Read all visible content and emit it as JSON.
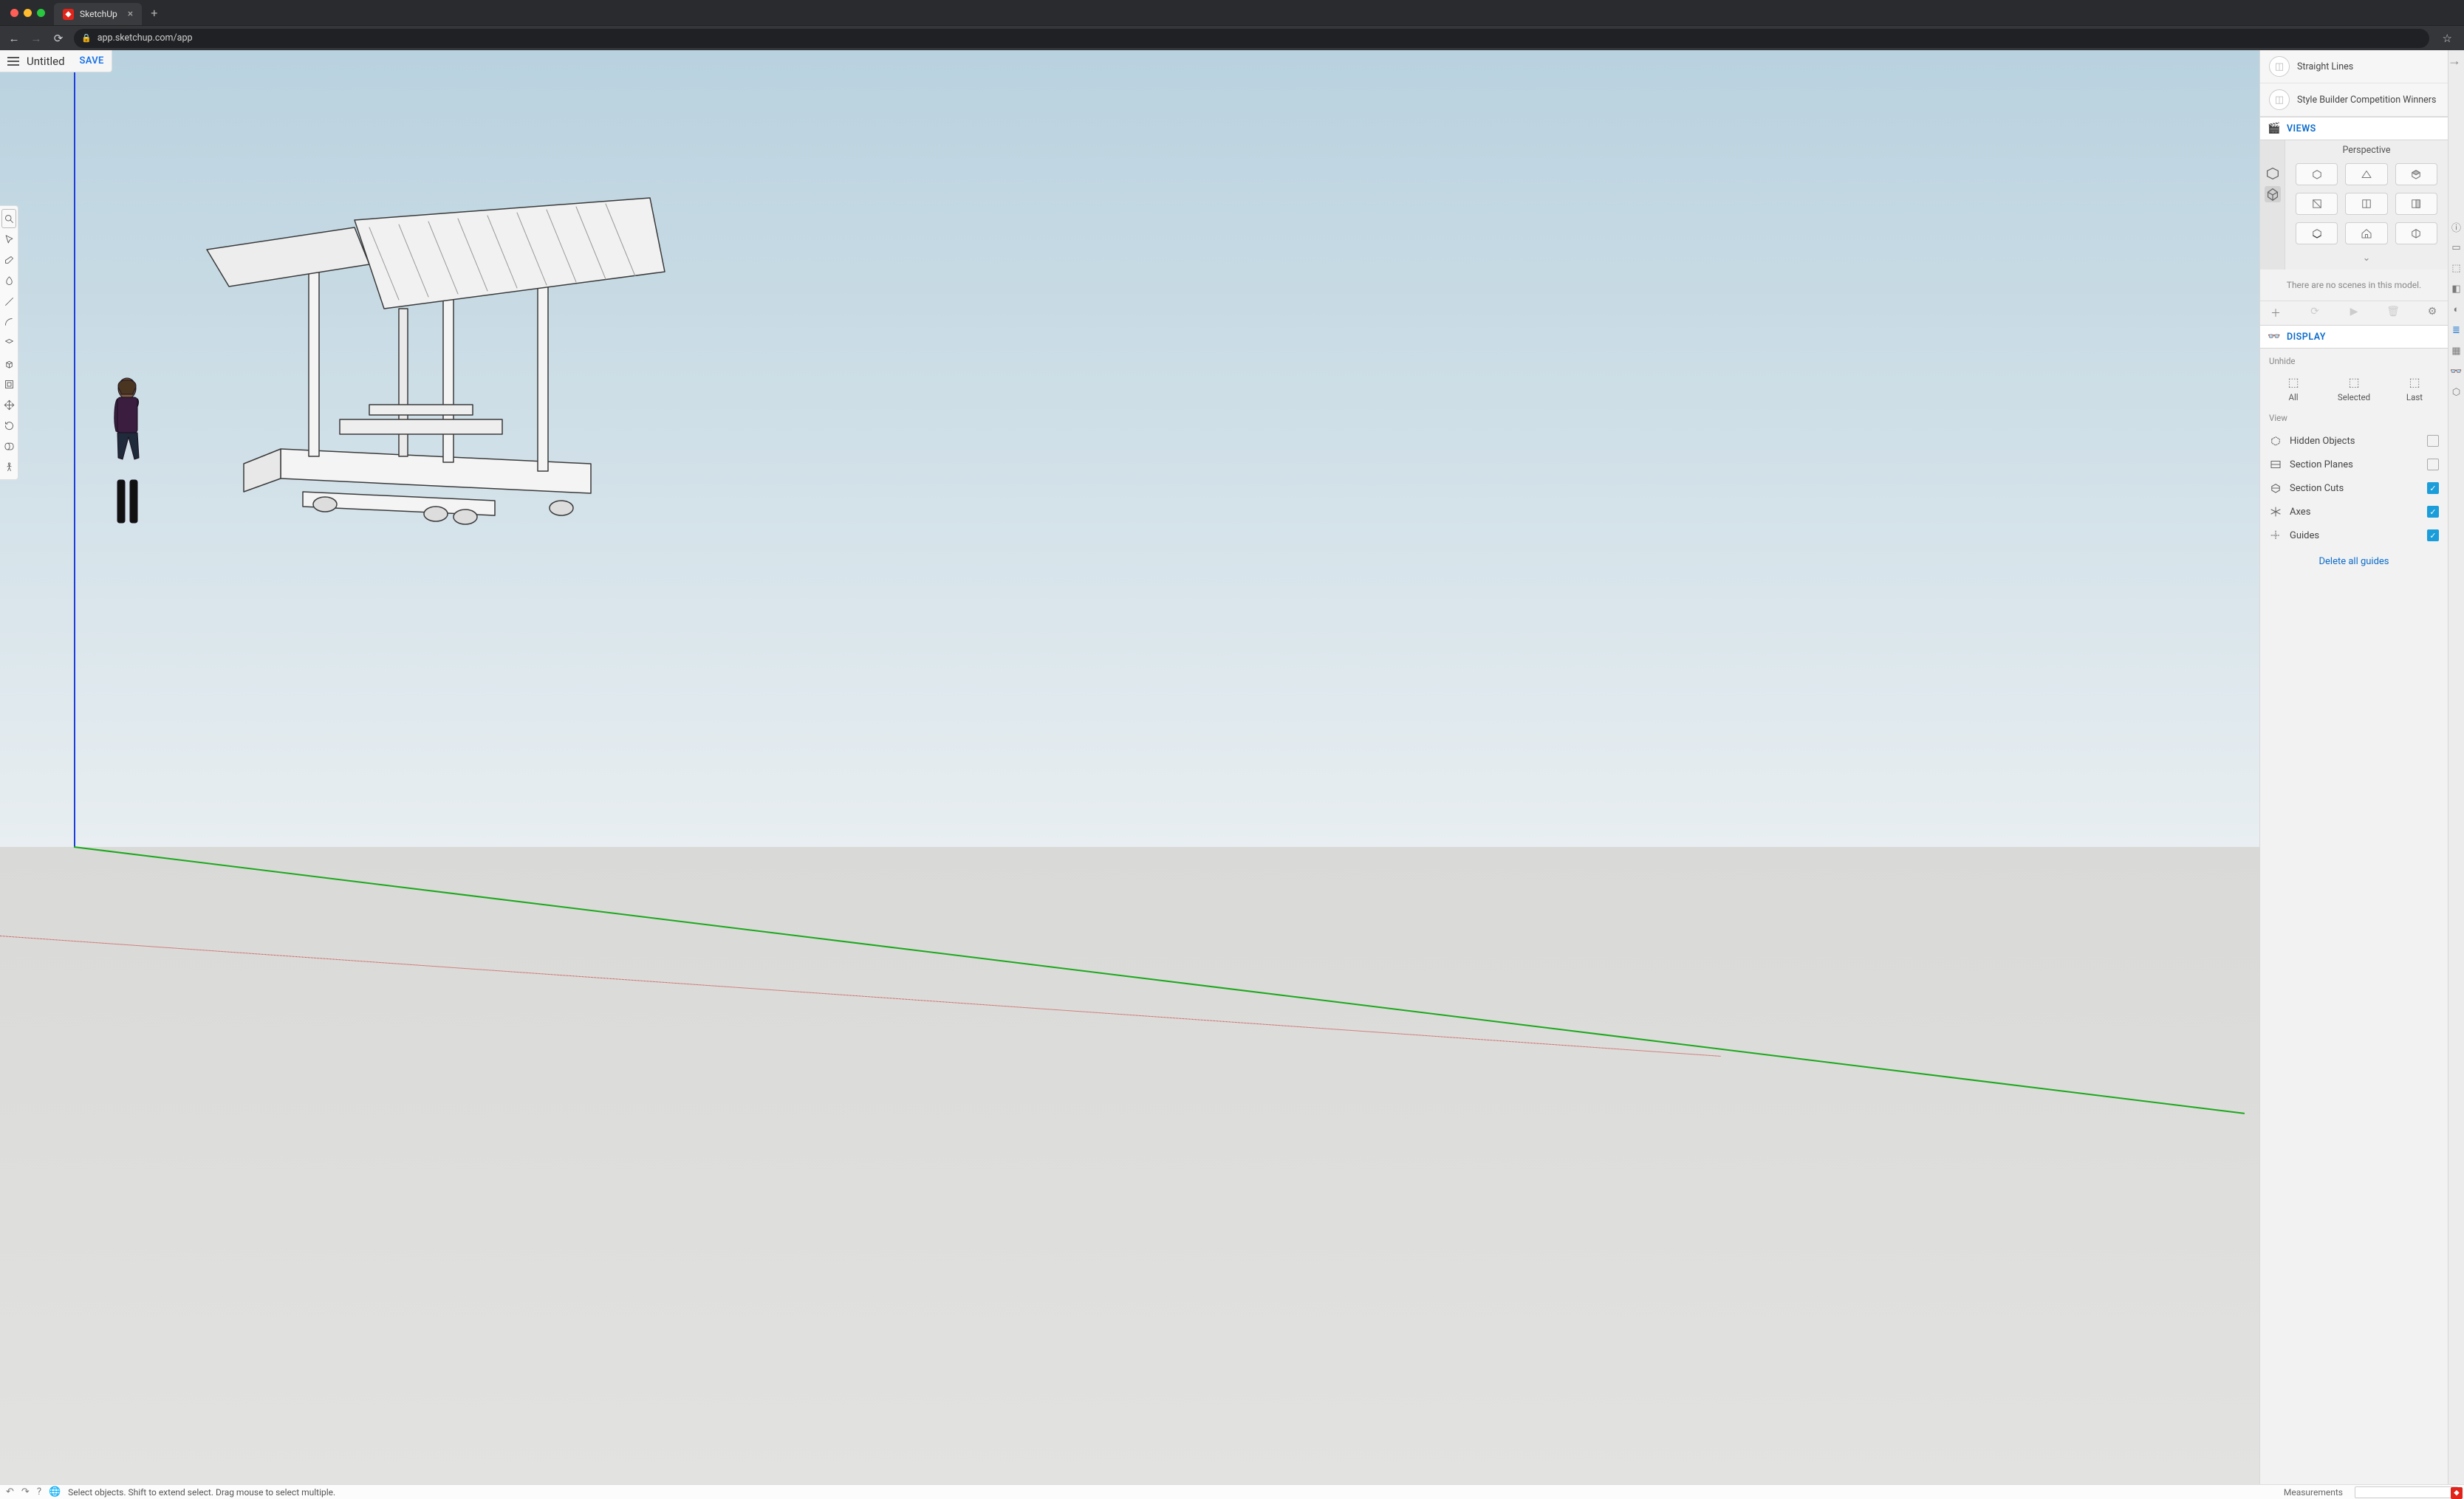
{
  "browser": {
    "tab_title": "SketchUp",
    "url": "app.sketchup.com/app"
  },
  "header": {
    "doc_title": "Untitled",
    "save_label": "SAVE"
  },
  "status": {
    "hint": "Select objects. Shift to extend select. Drag mouse to select multiple.",
    "measurements_label": "Measurements"
  },
  "styles": {
    "item1": "Straight Lines",
    "item2": "Style Builder Competition Winners"
  },
  "views": {
    "section_label": "VIEWS",
    "projection_label": "Perspective",
    "no_scenes_msg": "There are no scenes in this model."
  },
  "display": {
    "section_label": "DISPLAY",
    "unhide_label": "Unhide",
    "unhide_all": "All",
    "unhide_selected": "Selected",
    "unhide_last": "Last",
    "view_label": "View",
    "opts": {
      "hidden_objects": "Hidden Objects",
      "section_planes": "Section Planes",
      "section_cuts": "Section Cuts",
      "axes": "Axes",
      "guides": "Guides"
    },
    "delete_guides": "Delete all guides"
  }
}
